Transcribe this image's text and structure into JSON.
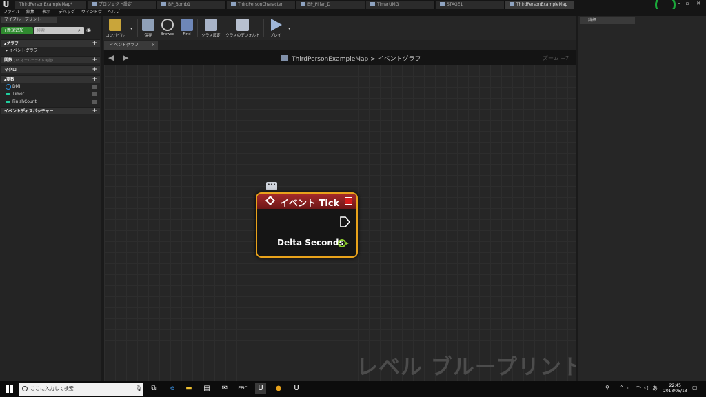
{
  "titlebar": {
    "tabs": [
      {
        "label": "ThirdPersonExampleMap*",
        "active": false
      },
      {
        "label": "プロジェクト設定",
        "active": false
      },
      {
        "label": "BP_Bomb1",
        "active": false
      },
      {
        "label": "ThirdPersonCharacter",
        "active": false
      },
      {
        "label": "BP_Pillar_D",
        "active": false
      },
      {
        "label": "TimerUMG",
        "active": false
      },
      {
        "label": "STAGE1",
        "active": false
      },
      {
        "label": "ThirdPersonExampleMap",
        "active": true
      }
    ]
  },
  "menubar": {
    "items": [
      "ファイル",
      "編集",
      "表示",
      "デバッグ",
      "ウィンドウ",
      "ヘルプ"
    ]
  },
  "left_panel": {
    "tab_label": "マイブループリント",
    "add_button": "+新規追加",
    "search_placeholder": "検索",
    "sections": {
      "graph": "グラフ",
      "event_graph": "イベントグラフ",
      "functions": "関数",
      "functions_hint": "(18 オーバーライド可能)",
      "macros": "マクロ",
      "variables": "変数",
      "dispatchers": "イベントディスパッチャー"
    },
    "variables": [
      "DMI",
      "Timer",
      "FinishCount"
    ]
  },
  "toolbar": {
    "buttons": [
      {
        "label": "コンパイル"
      },
      {
        "label": "保存"
      },
      {
        "label": "Browse"
      },
      {
        "label": "Find"
      },
      {
        "label": "クラス設定"
      },
      {
        "label": "クラスのデフォルト"
      },
      {
        "label": "プレイ"
      }
    ]
  },
  "graph": {
    "tab_label": "イベントグラフ",
    "breadcrumb_root": "ThirdPersonExampleMap",
    "breadcrumb_sep": ">",
    "breadcrumb_leaf": "イベントグラフ",
    "zoom": "ズーム +7",
    "watermark": "レベル ブループリント",
    "comment_bubble": "•••",
    "node": {
      "title": "イベント Tick",
      "output_pin": "Delta Seconds",
      "header_color": "#a52a2a",
      "border_color": "#e8a21b",
      "pin_color": "#8fd12e"
    }
  },
  "right_panel": {
    "tab_label": "詳細"
  },
  "taskbar": {
    "search_placeholder": "ここに入力して検索",
    "time": "22:45",
    "date": "2018/05/13"
  }
}
